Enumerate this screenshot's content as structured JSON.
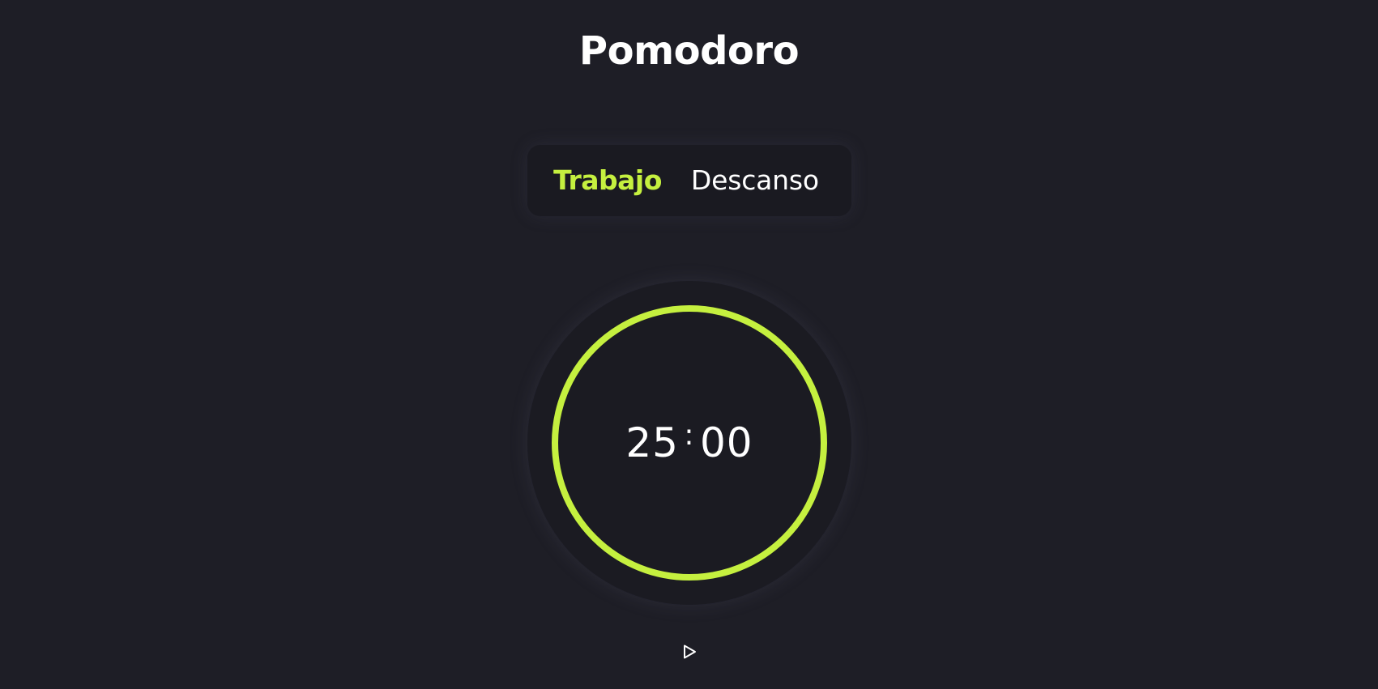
{
  "app": {
    "title": "Pomodoro"
  },
  "modes": {
    "active": "Trabajo",
    "inactive": "Descanso"
  },
  "timer": {
    "minutes": "25",
    "separator": ":",
    "seconds": "00",
    "progress": 1.0
  },
  "controls": {
    "play_icon": "play-icon"
  },
  "colors": {
    "background": "#1e1e26",
    "accent": "#c5f03f",
    "text": "#ffffff"
  }
}
